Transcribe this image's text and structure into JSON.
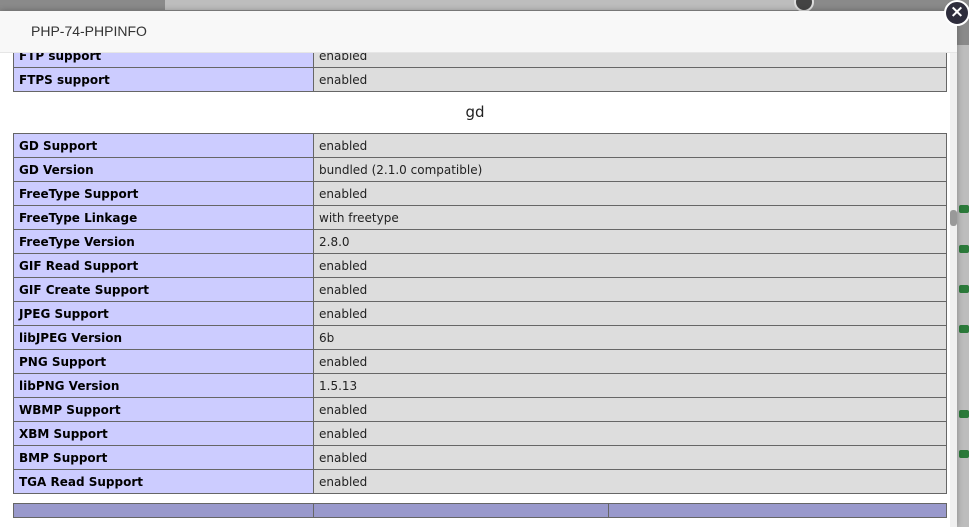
{
  "dialog": {
    "title": "PHP-74-PHPINFO",
    "close_icon": "×"
  },
  "sections": {
    "ftp_rows": [
      {
        "name": "FTP support",
        "value": "enabled"
      },
      {
        "name": "FTPS support",
        "value": "enabled"
      }
    ],
    "gd_title": "gd",
    "gd_rows": [
      {
        "name": "GD Support",
        "value": "enabled"
      },
      {
        "name": "GD Version",
        "value": "bundled (2.1.0 compatible)"
      },
      {
        "name": "FreeType Support",
        "value": "enabled"
      },
      {
        "name": "FreeType Linkage",
        "value": "with freetype"
      },
      {
        "name": "FreeType Version",
        "value": "2.8.0"
      },
      {
        "name": "GIF Read Support",
        "value": "enabled"
      },
      {
        "name": "GIF Create Support",
        "value": "enabled"
      },
      {
        "name": "JPEG Support",
        "value": "enabled"
      },
      {
        "name": "libJPEG Version",
        "value": "6b"
      },
      {
        "name": "PNG Support",
        "value": "enabled"
      },
      {
        "name": "libPNG Version",
        "value": "1.5.13"
      },
      {
        "name": "WBMP Support",
        "value": "enabled"
      },
      {
        "name": "XBM Support",
        "value": "enabled"
      },
      {
        "name": "BMP Support",
        "value": "enabled"
      },
      {
        "name": "TGA Read Support",
        "value": "enabled"
      }
    ]
  },
  "colors": {
    "key_cell": "#ccccff",
    "value_cell": "#dddddd",
    "header_cell": "#9999cc"
  }
}
